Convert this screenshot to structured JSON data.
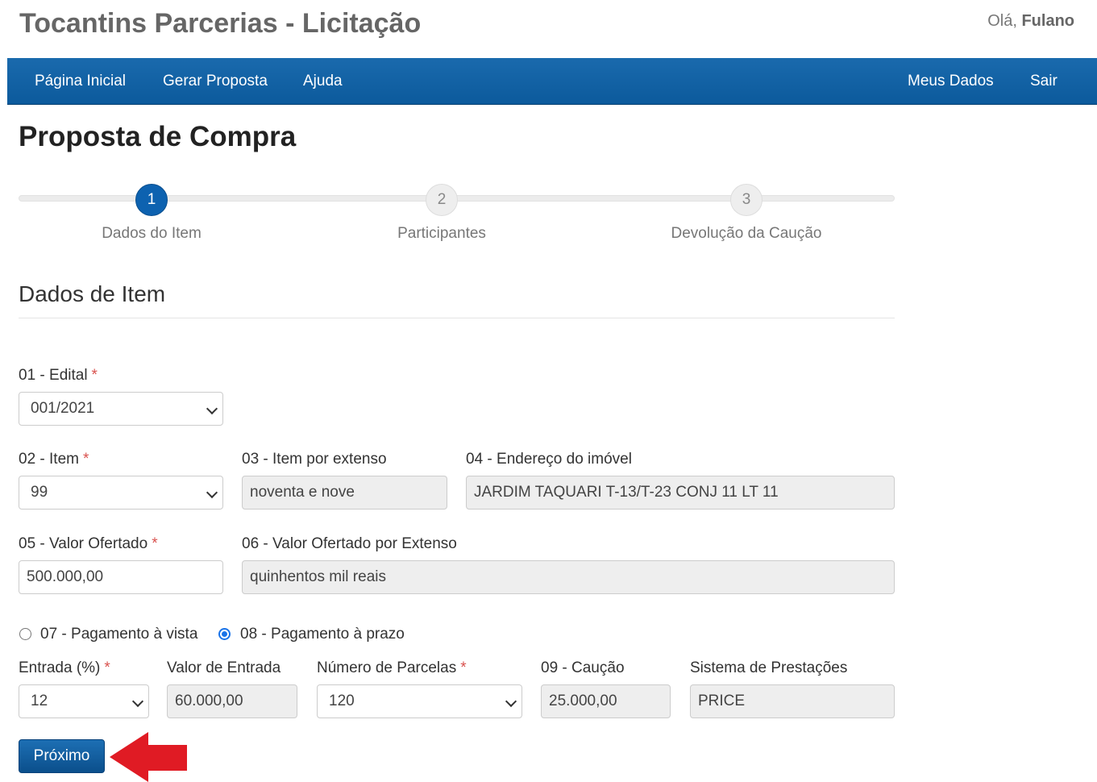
{
  "header": {
    "app_title": "Tocantins Parcerias - Licitação",
    "greeting": "Olá,",
    "user_name": "Fulano"
  },
  "nav": {
    "home": "Página Inicial",
    "generate": "Gerar Proposta",
    "help": "Ajuda",
    "my_data": "Meus Dados",
    "logout": "Sair"
  },
  "colors": {
    "brand": "#0c5a9c",
    "step_active": "#0d62b0",
    "required": "#d9534f",
    "annotation_arrow": "#e01b24"
  },
  "page_title": "Proposta de Compra",
  "stepper": {
    "current_step": 1,
    "steps": [
      {
        "number": "1",
        "label": "Dados do Item"
      },
      {
        "number": "2",
        "label": "Participantes"
      },
      {
        "number": "3",
        "label": "Devolução da Caução"
      }
    ]
  },
  "section_title": "Dados de Item",
  "form": {
    "edital": {
      "label": "01 - Edital",
      "required": "*",
      "value": "001/2021"
    },
    "item": {
      "label": "02 - Item",
      "required": "*",
      "value": "99"
    },
    "item_extenso": {
      "label": "03 - Item por extenso",
      "value": "noventa e nove"
    },
    "endereco": {
      "label": "04 - Endereço do imóvel",
      "value": "JARDIM TAQUARI T-13/T-23 CONJ 11 LT 11"
    },
    "valor_ofertado": {
      "label": "05 - Valor Ofertado",
      "required": "*",
      "value": "500.000,00"
    },
    "valor_extenso": {
      "label": "06 - Valor Ofertado por Extenso",
      "value": "quinhentos mil reais"
    },
    "pagamento_vista": {
      "label": "07 - Pagamento à vista",
      "selected": false
    },
    "pagamento_prazo": {
      "label": "08 - Pagamento à prazo",
      "selected": true
    },
    "entrada": {
      "label": "Entrada (%)",
      "required": "*",
      "value": "12"
    },
    "valor_entrada": {
      "label": "Valor de Entrada",
      "value": "60.000,00"
    },
    "parcelas": {
      "label": "Número de Parcelas",
      "required": "*",
      "value": "120"
    },
    "caucao": {
      "label": "09 - Caução",
      "value": "25.000,00"
    },
    "sistema": {
      "label": "Sistema de Prestações",
      "value": "PRICE"
    }
  },
  "next_button": "Próximo"
}
